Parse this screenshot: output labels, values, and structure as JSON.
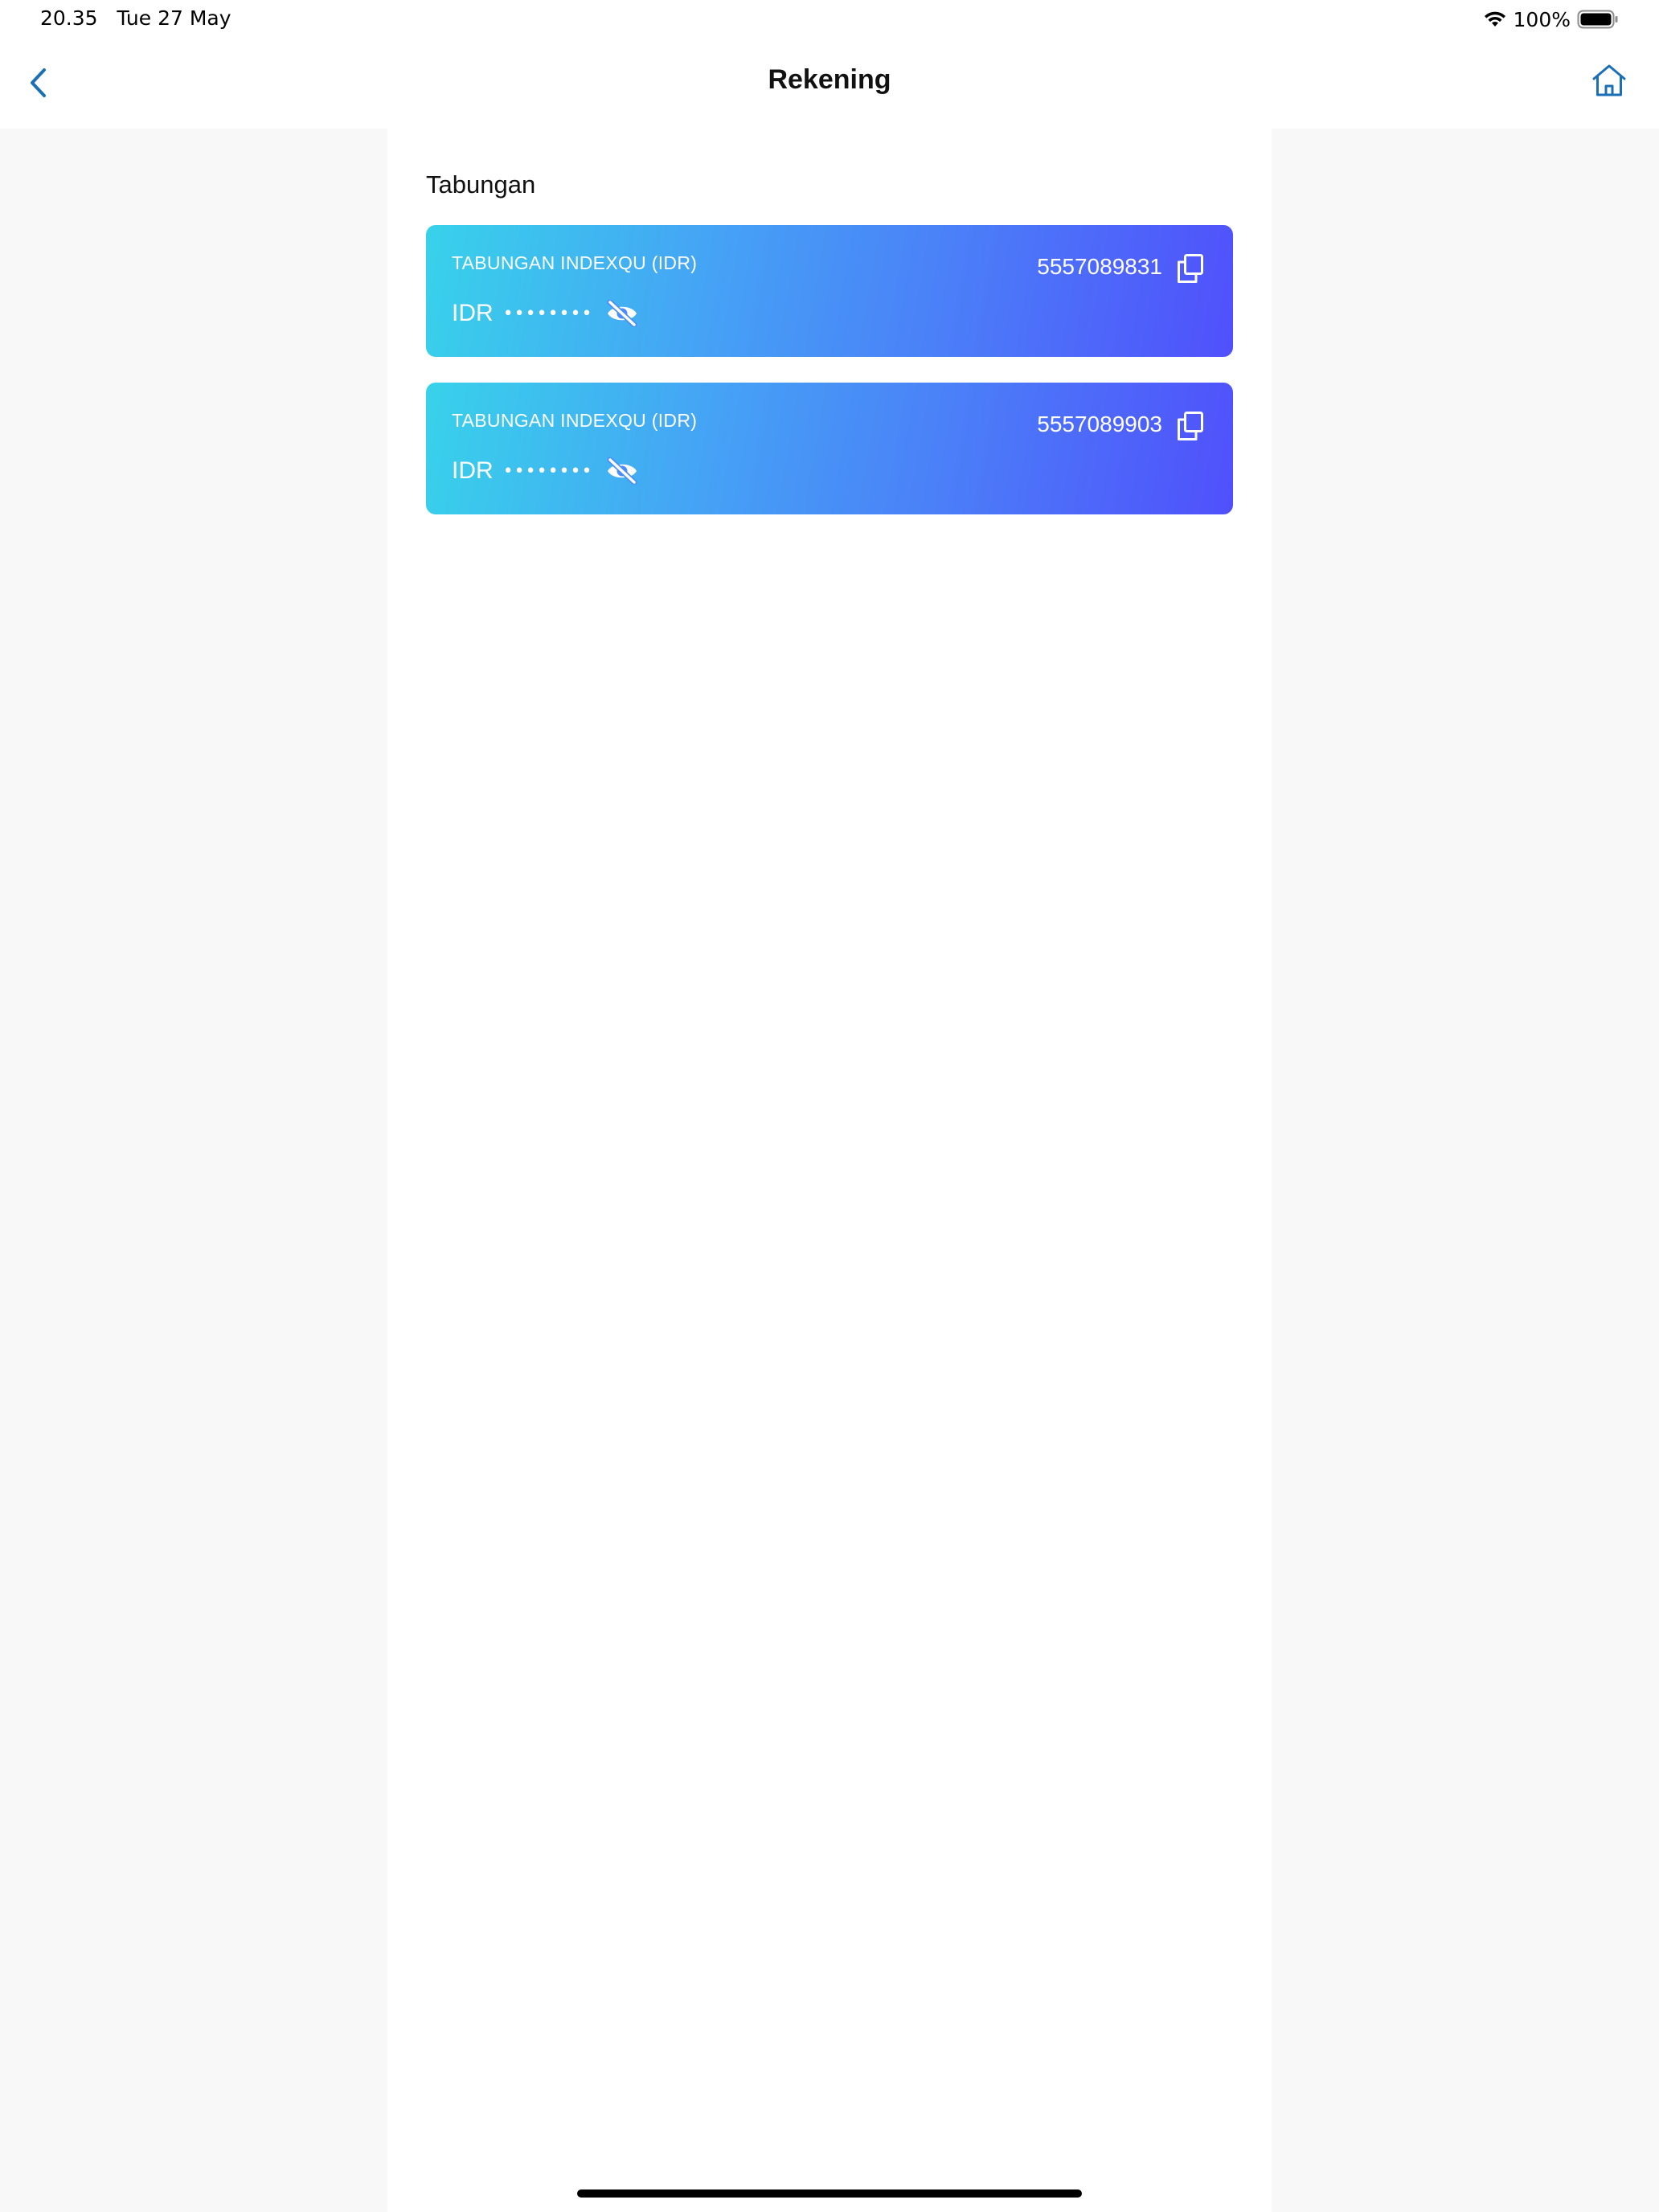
{
  "status_bar": {
    "time": "20.35",
    "date": "Tue 27 May",
    "battery": "100%"
  },
  "nav": {
    "title": "Rekening",
    "back_icon": "chevron-left-icon",
    "home_icon": "home-icon"
  },
  "section": {
    "title": "Tabungan"
  },
  "accounts": [
    {
      "name": "TABUNGAN INDEXQU (IDR)",
      "number": "5557089831",
      "currency": "IDR",
      "balance_masked": "••••••••"
    },
    {
      "name": "TABUNGAN INDEXQU (IDR)",
      "number": "5557089903",
      "currency": "IDR",
      "balance_masked": "••••••••"
    }
  ],
  "colors": {
    "accent": "#1a6fb5",
    "card_gradient_start": "#38d2ea",
    "card_gradient_end": "#5050fb"
  }
}
